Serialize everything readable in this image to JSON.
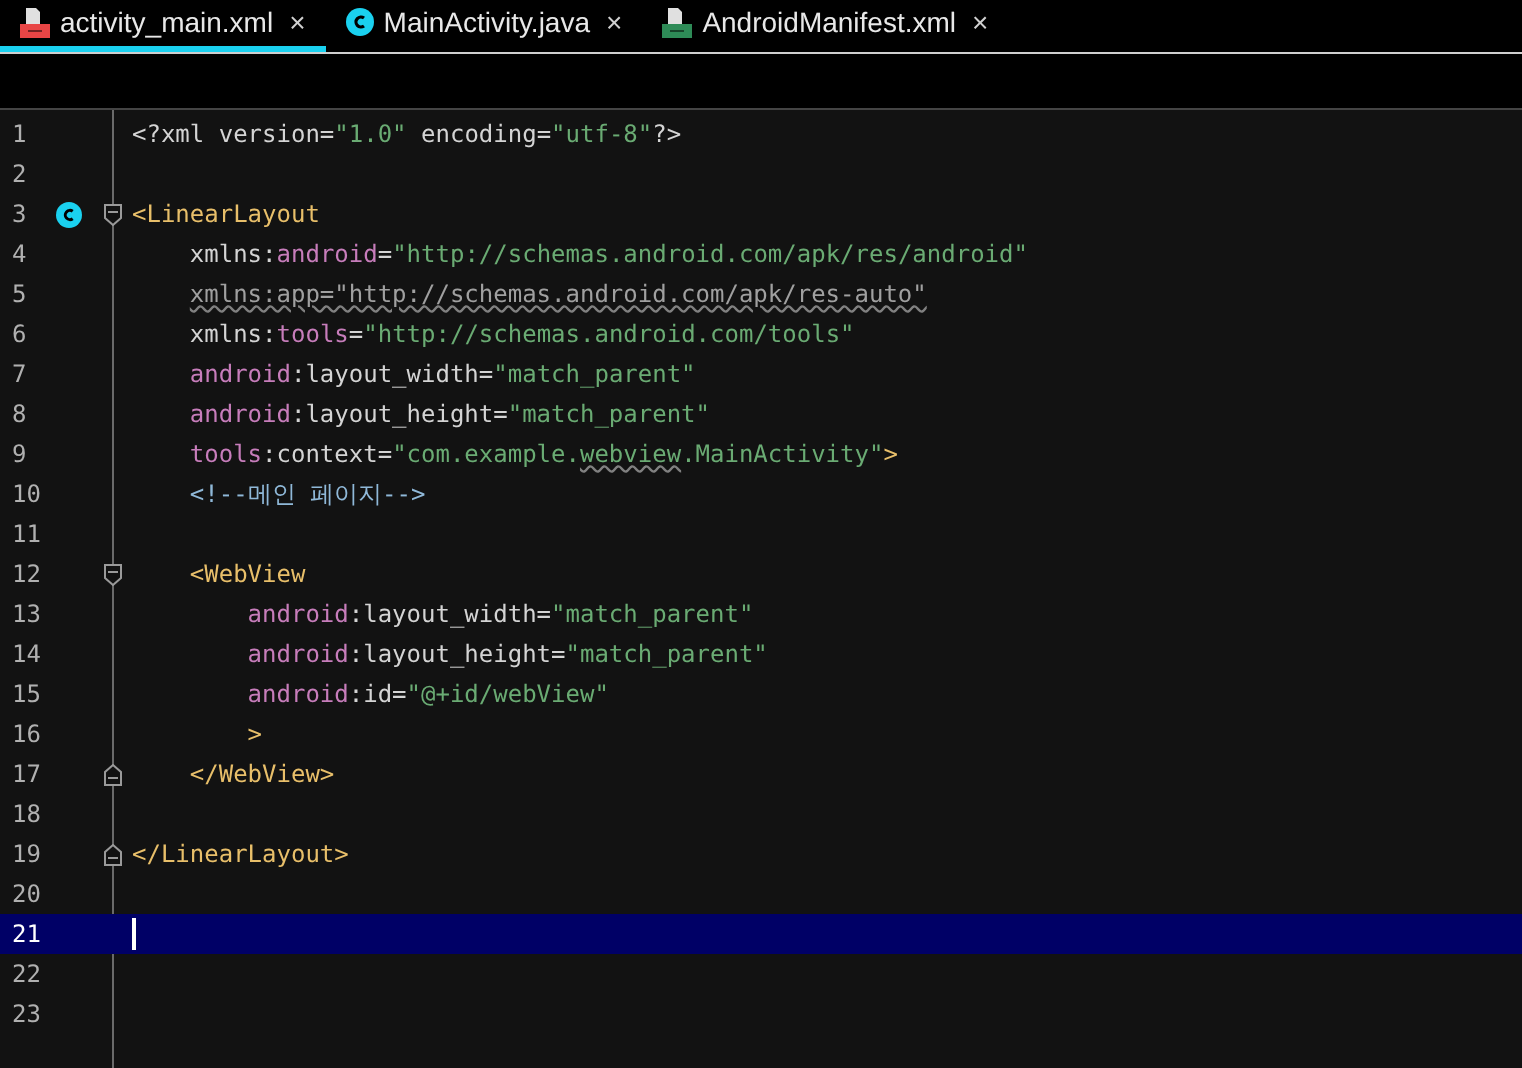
{
  "tabs": [
    {
      "kind": "xml",
      "label": "activity_main.xml",
      "close": "×",
      "selected": true
    },
    {
      "kind": "class",
      "label": "MainActivity.java",
      "close": "×",
      "selected": false
    },
    {
      "kind": "manifest",
      "label": "AndroidManifest.xml",
      "close": "×",
      "selected": false
    }
  ],
  "lines": [
    {
      "number": "1",
      "fold_start": false,
      "fold_end": false,
      "marker": false,
      "selected": false,
      "tokens": [
        {
          "kind": "plain",
          "text": "<?xml version="
        },
        {
          "kind": "value",
          "text": "\"1.0\""
        },
        {
          "kind": "plain",
          "text": " encoding="
        },
        {
          "kind": "value",
          "text": "\"utf-8\""
        },
        {
          "kind": "plain",
          "text": "?>"
        }
      ]
    },
    {
      "number": "2",
      "fold_start": false,
      "fold_end": false,
      "marker": false,
      "selected": false
    },
    {
      "number": "3",
      "fold_start": true,
      "fold_end": false,
      "marker": true,
      "selected": false,
      "tokens": [
        {
          "kind": "tag",
          "text": "<LinearLayout"
        }
      ]
    },
    {
      "number": "4",
      "fold_start": false,
      "fold_end": false,
      "marker": false,
      "selected": false,
      "tokens": [
        {
          "kind": "plain",
          "text": "    xmlns:"
        },
        {
          "kind": "ns",
          "text": "android"
        },
        {
          "kind": "plain",
          "text": "="
        },
        {
          "kind": "value",
          "text": "\"http://schemas.android.com/apk/res/android\""
        }
      ]
    },
    {
      "number": "5",
      "fold_start": false,
      "fold_end": false,
      "marker": false,
      "selected": false,
      "tokens": [
        {
          "kind": "unused",
          "text": "    xmlns:app=\"http://schemas.android.com/apk/res-auto\""
        }
      ]
    },
    {
      "number": "6",
      "fold_start": false,
      "fold_end": false,
      "marker": false,
      "selected": false,
      "tokens": [
        {
          "kind": "plain",
          "text": "    xmlns:"
        },
        {
          "kind": "ns",
          "text": "tools"
        },
        {
          "kind": "plain",
          "text": "="
        },
        {
          "kind": "value",
          "text": "\"http://schemas.android.com/tools\""
        }
      ]
    },
    {
      "number": "7",
      "fold_start": false,
      "fold_end": false,
      "marker": false,
      "selected": false,
      "tokens": [
        {
          "kind": "ns",
          "text": "    android"
        },
        {
          "kind": "plain",
          "text": ":layout_width="
        },
        {
          "kind": "value",
          "text": "\"match_parent\""
        }
      ]
    },
    {
      "number": "8",
      "fold_start": false,
      "fold_end": false,
      "marker": false,
      "selected": false,
      "tokens": [
        {
          "kind": "ns",
          "text": "    android"
        },
        {
          "kind": "plain",
          "text": ":layout_height="
        },
        {
          "kind": "value",
          "text": "\"match_parent\""
        }
      ]
    },
    {
      "number": "9",
      "fold_start": false,
      "fold_end": false,
      "marker": false,
      "selected": false,
      "tokens": [
        {
          "kind": "ns",
          "text": "    tools"
        },
        {
          "kind": "plain",
          "text": ":context="
        },
        {
          "kind": "value",
          "text": "\"com.example."
        },
        {
          "kind": "typo",
          "text": "webview"
        },
        {
          "kind": "value",
          "text": ".MainActivity\""
        },
        {
          "kind": "tag",
          "text": ">"
        }
      ]
    },
    {
      "number": "10",
      "fold_start": false,
      "fold_end": false,
      "marker": false,
      "selected": false,
      "tokens": [
        {
          "kind": "comment",
          "text": "    <!--메인 페이지-->"
        }
      ]
    },
    {
      "number": "11",
      "fold_start": false,
      "fold_end": false,
      "marker": false,
      "selected": false
    },
    {
      "number": "12",
      "fold_start": true,
      "fold_end": false,
      "marker": false,
      "selected": false,
      "tokens": [
        {
          "kind": "tag",
          "text": "    <WebView"
        }
      ]
    },
    {
      "number": "13",
      "fold_start": false,
      "fold_end": false,
      "marker": false,
      "selected": false,
      "tokens": [
        {
          "kind": "ns",
          "text": "        android"
        },
        {
          "kind": "plain",
          "text": ":layout_width="
        },
        {
          "kind": "value",
          "text": "\"match_parent\""
        }
      ]
    },
    {
      "number": "14",
      "fold_start": false,
      "fold_end": false,
      "marker": false,
      "selected": false,
      "tokens": [
        {
          "kind": "ns",
          "text": "        android"
        },
        {
          "kind": "plain",
          "text": ":layout_height="
        },
        {
          "kind": "value",
          "text": "\"match_parent\""
        }
      ]
    },
    {
      "number": "15",
      "fold_start": false,
      "fold_end": false,
      "marker": false,
      "selected": false,
      "tokens": [
        {
          "kind": "ns",
          "text": "        android"
        },
        {
          "kind": "plain",
          "text": ":id="
        },
        {
          "kind": "value",
          "text": "\"@+id/webView\""
        }
      ]
    },
    {
      "number": "16",
      "fold_start": false,
      "fold_end": false,
      "marker": false,
      "selected": false,
      "tokens": [
        {
          "kind": "tag",
          "text": "        >"
        }
      ]
    },
    {
      "number": "17",
      "fold_start": false,
      "fold_end": true,
      "marker": false,
      "selected": false,
      "tokens": [
        {
          "kind": "tag",
          "text": "    </WebView>"
        }
      ]
    },
    {
      "number": "18",
      "fold_start": false,
      "fold_end": false,
      "marker": false,
      "selected": false
    },
    {
      "number": "19",
      "fold_start": false,
      "fold_end": true,
      "marker": false,
      "selected": false,
      "tokens": [
        {
          "kind": "tag",
          "text": "</LinearLayout>"
        }
      ]
    },
    {
      "number": "20",
      "fold_start": false,
      "fold_end": false,
      "marker": false,
      "selected": false
    },
    {
      "number": "21",
      "fold_start": false,
      "fold_end": false,
      "marker": false,
      "selected": true
    },
    {
      "number": "22",
      "fold_start": false,
      "fold_end": false,
      "marker": false,
      "selected": false
    },
    {
      "number": "23",
      "fold_start": false,
      "fold_end": false,
      "marker": false,
      "selected": false
    }
  ]
}
